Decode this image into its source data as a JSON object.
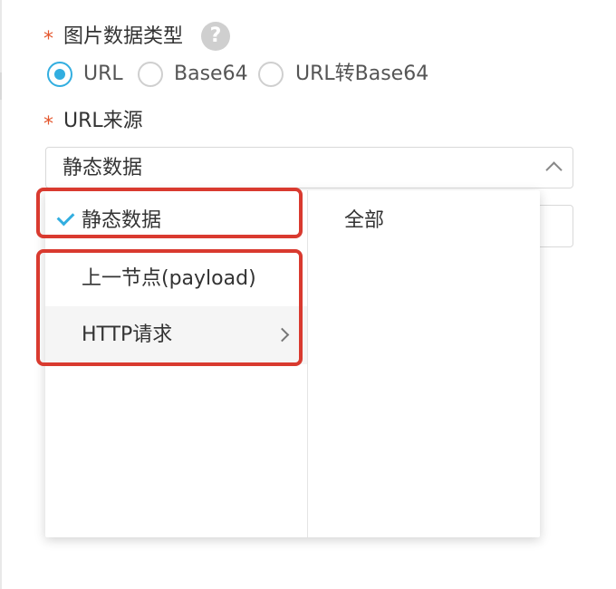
{
  "form": {
    "image_type": {
      "required_mark": "*",
      "label": "图片数据类型",
      "help_icon": "?",
      "options": [
        {
          "label": "URL",
          "checked": true
        },
        {
          "label": "Base64",
          "checked": false
        },
        {
          "label": "URL转Base64",
          "checked": false
        }
      ]
    },
    "url_source": {
      "required_mark": "*",
      "label": "URL来源",
      "selected_value": "静态数据"
    }
  },
  "dropdown": {
    "left_column": [
      {
        "label": "静态数据",
        "selected": true
      },
      {
        "label": "上一节点(payload)",
        "selected": false
      },
      {
        "label": "HTTP请求",
        "selected": false,
        "has_submenu": true
      }
    ],
    "right_column": [
      {
        "label": "全部"
      }
    ]
  },
  "colors": {
    "accent": "#32aee0",
    "required": "#e4572e",
    "highlight": "#d93a2f"
  }
}
